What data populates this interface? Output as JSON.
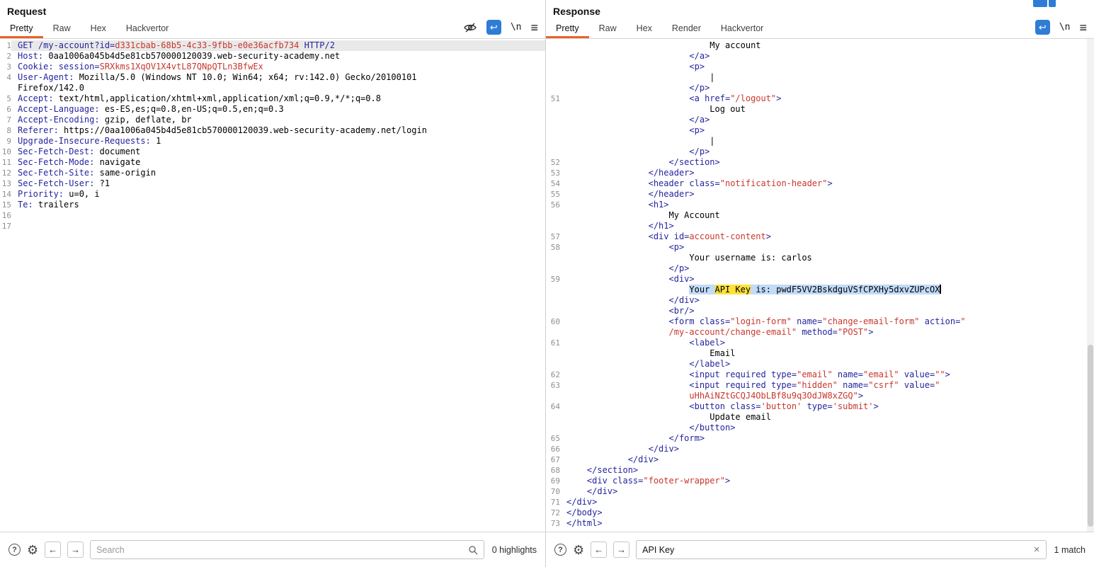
{
  "colors": {
    "syntax-blue": "#24249f",
    "syntax-red": "#c8372d",
    "selection": "#c2dbf7",
    "search-highlight": "#ffe13c",
    "accent-orange": "#e8632c",
    "wrap-blue": "#2e7cd6",
    "selected-line": "#e9e9e9"
  },
  "icons": {
    "wrap": "↩",
    "newline": "\\n",
    "menu": "≡",
    "help": "?",
    "gear": "⚙",
    "prev": "←",
    "next": "→",
    "clear": "×"
  },
  "request": {
    "title": "Request",
    "tabs": [
      "Pretty",
      "Raw",
      "Hex",
      "Hackvertor"
    ],
    "active_tab": "Pretty",
    "footer": {
      "search_placeholder": "Search",
      "count_label": "0 highlights"
    },
    "rows": [
      {
        "n": "1",
        "sel": true,
        "segs": [
          [
            "b",
            "GET /my-account?id="
          ],
          [
            "r",
            "d331cbab-68b5-4c33-9fbb-e0e36acfb734"
          ],
          [
            "b",
            " HTTP/2"
          ]
        ]
      },
      {
        "n": "2",
        "segs": [
          [
            "b",
            "Host:"
          ],
          [
            "k",
            " 0aa1006a045b4d5e81cb570000120039.web-security-academy.net"
          ]
        ]
      },
      {
        "n": "3",
        "segs": [
          [
            "b",
            "Cookie: session="
          ],
          [
            "r",
            "SRXkms1XqOV1X4vtL87QNpQTLn3BfwEx"
          ]
        ]
      },
      {
        "n": "4",
        "segs": [
          [
            "b",
            "User-Agent:"
          ],
          [
            "k",
            " Mozilla/5.0 (Windows NT 10.0; Win64; x64; rv:142.0) Gecko/20100101"
          ]
        ]
      },
      {
        "n": "",
        "segs": [
          [
            "k",
            "Firefox/142.0"
          ]
        ]
      },
      {
        "n": "5",
        "segs": [
          [
            "b",
            "Accept:"
          ],
          [
            "k",
            " text/html,application/xhtml+xml,application/xml;q=0.9,*/*;q=0.8"
          ]
        ]
      },
      {
        "n": "6",
        "segs": [
          [
            "b",
            "Accept-Language:"
          ],
          [
            "k",
            " es-ES,es;q=0.8,en-US;q=0.5,en;q=0.3"
          ]
        ]
      },
      {
        "n": "7",
        "segs": [
          [
            "b",
            "Accept-Encoding:"
          ],
          [
            "k",
            " gzip, deflate, br"
          ]
        ]
      },
      {
        "n": "8",
        "segs": [
          [
            "b",
            "Referer:"
          ],
          [
            "k",
            " https://0aa1006a045b4d5e81cb570000120039.web-security-academy.net/login"
          ]
        ]
      },
      {
        "n": "9",
        "segs": [
          [
            "b",
            "Upgrade-Insecure-Requests:"
          ],
          [
            "k",
            " 1"
          ]
        ]
      },
      {
        "n": "10",
        "segs": [
          [
            "b",
            "Sec-Fetch-Dest:"
          ],
          [
            "k",
            " document"
          ]
        ]
      },
      {
        "n": "11",
        "segs": [
          [
            "b",
            "Sec-Fetch-Mode:"
          ],
          [
            "k",
            " navigate"
          ]
        ]
      },
      {
        "n": "12",
        "segs": [
          [
            "b",
            "Sec-Fetch-Site:"
          ],
          [
            "k",
            " same-origin"
          ]
        ]
      },
      {
        "n": "13",
        "segs": [
          [
            "b",
            "Sec-Fetch-User:"
          ],
          [
            "k",
            " ?1"
          ]
        ]
      },
      {
        "n": "14",
        "segs": [
          [
            "b",
            "Priority:"
          ],
          [
            "k",
            " u=0, i"
          ]
        ]
      },
      {
        "n": "15",
        "segs": [
          [
            "b",
            "Te:"
          ],
          [
            "k",
            " trailers"
          ]
        ]
      },
      {
        "n": "16",
        "segs": []
      },
      {
        "n": "17",
        "segs": []
      }
    ]
  },
  "response": {
    "title": "Response",
    "tabs": [
      "Pretty",
      "Raw",
      "Hex",
      "Render",
      "Hackvertor"
    ],
    "active_tab": "Pretty",
    "footer": {
      "search_value": "API Key",
      "count_label": "1 match"
    },
    "rows": [
      {
        "n": "",
        "segs": [
          [
            "k",
            "                            My account"
          ]
        ]
      },
      {
        "n": "",
        "segs": [
          [
            "b",
            "                        </a>"
          ]
        ]
      },
      {
        "n": "",
        "segs": [
          [
            "b",
            "                        <p>"
          ]
        ]
      },
      {
        "n": "",
        "segs": [
          [
            "k",
            "                            |"
          ]
        ]
      },
      {
        "n": "",
        "segs": [
          [
            "b",
            "                        </p>"
          ]
        ]
      },
      {
        "n": "51",
        "segs": [
          [
            "b",
            "                        <a href="
          ],
          [
            "r",
            "\"/logout\""
          ],
          [
            "b",
            ">"
          ]
        ]
      },
      {
        "n": "",
        "segs": [
          [
            "k",
            "                            Log out"
          ]
        ]
      },
      {
        "n": "",
        "segs": [
          [
            "b",
            "                        </a>"
          ]
        ]
      },
      {
        "n": "",
        "segs": [
          [
            "b",
            "                        <p>"
          ]
        ]
      },
      {
        "n": "",
        "segs": [
          [
            "k",
            "                            |"
          ]
        ]
      },
      {
        "n": "",
        "segs": [
          [
            "b",
            "                        </p>"
          ]
        ]
      },
      {
        "n": "52",
        "segs": [
          [
            "b",
            "                    </section>"
          ]
        ]
      },
      {
        "n": "53",
        "segs": [
          [
            "b",
            "                </header>"
          ]
        ]
      },
      {
        "n": "54",
        "segs": [
          [
            "b",
            "                <header class="
          ],
          [
            "r",
            "\"notification-header\""
          ],
          [
            "b",
            ">"
          ]
        ]
      },
      {
        "n": "55",
        "segs": [
          [
            "b",
            "                </header>"
          ]
        ]
      },
      {
        "n": "56",
        "segs": [
          [
            "b",
            "                <h1>"
          ]
        ]
      },
      {
        "n": "",
        "segs": [
          [
            "k",
            "                    My Account"
          ]
        ]
      },
      {
        "n": "",
        "segs": [
          [
            "b",
            "                </h1>"
          ]
        ]
      },
      {
        "n": "57",
        "segs": [
          [
            "b",
            "                <div id="
          ],
          [
            "r",
            "account-content"
          ],
          [
            "b",
            ">"
          ]
        ]
      },
      {
        "n": "58",
        "segs": [
          [
            "b",
            "                    <p>"
          ]
        ]
      },
      {
        "n": "",
        "segs": [
          [
            "k",
            "                        Your username is: carlos"
          ]
        ]
      },
      {
        "n": "",
        "segs": [
          [
            "b",
            "                    </p>"
          ]
        ]
      },
      {
        "n": "59",
        "segs": [
          [
            "b",
            "                    <div>"
          ]
        ]
      },
      {
        "n": "",
        "cursor": true,
        "segs": [
          [
            "k",
            "                        "
          ],
          [
            "s",
            "Your "
          ],
          [
            "sy",
            "API Key"
          ],
          [
            "s",
            " is: pwdF5VV2BskdguVSfCPXHy5dxvZUPcOX"
          ]
        ]
      },
      {
        "n": "",
        "segs": [
          [
            "b",
            "                    </div>"
          ]
        ]
      },
      {
        "n": "",
        "segs": [
          [
            "b",
            "                    <br/>"
          ]
        ]
      },
      {
        "n": "60",
        "segs": [
          [
            "b",
            "                    <form class="
          ],
          [
            "r",
            "\"login-form\""
          ],
          [
            "b",
            " name="
          ],
          [
            "r",
            "\"change-email-form\""
          ],
          [
            "b",
            " action="
          ],
          [
            "r",
            "\""
          ]
        ]
      },
      {
        "n": "",
        "segs": [
          [
            "r",
            "                    /my-account/change-email\""
          ],
          [
            "b",
            " method="
          ],
          [
            "r",
            "\"POST\""
          ],
          [
            "b",
            ">"
          ]
        ]
      },
      {
        "n": "61",
        "segs": [
          [
            "b",
            "                        <label>"
          ]
        ]
      },
      {
        "n": "",
        "segs": [
          [
            "k",
            "                            Email"
          ]
        ]
      },
      {
        "n": "",
        "segs": [
          [
            "b",
            "                        </label>"
          ]
        ]
      },
      {
        "n": "62",
        "segs": [
          [
            "b",
            "                        <input required type="
          ],
          [
            "r",
            "\"email\""
          ],
          [
            "b",
            " name="
          ],
          [
            "r",
            "\"email\""
          ],
          [
            "b",
            " value="
          ],
          [
            "r",
            "\"\""
          ],
          [
            "b",
            ">"
          ]
        ]
      },
      {
        "n": "63",
        "segs": [
          [
            "b",
            "                        <input required type="
          ],
          [
            "r",
            "\"hidden\""
          ],
          [
            "b",
            " name="
          ],
          [
            "r",
            "\"csrf\""
          ],
          [
            "b",
            " value="
          ],
          [
            "r",
            "\""
          ]
        ]
      },
      {
        "n": "",
        "segs": [
          [
            "r",
            "                        uHhAiNZtGCQJ4ObLBf8u9q3OdJW8xZGQ\""
          ],
          [
            "b",
            ">"
          ]
        ]
      },
      {
        "n": "64",
        "segs": [
          [
            "b",
            "                        <button class="
          ],
          [
            "r",
            "'button'"
          ],
          [
            "b",
            " type="
          ],
          [
            "r",
            "'submit'"
          ],
          [
            "b",
            ">"
          ]
        ]
      },
      {
        "n": "",
        "segs": [
          [
            "k",
            "                            Update email"
          ]
        ]
      },
      {
        "n": "",
        "segs": [
          [
            "b",
            "                        </button>"
          ]
        ]
      },
      {
        "n": "65",
        "segs": [
          [
            "b",
            "                    </form>"
          ]
        ]
      },
      {
        "n": "66",
        "segs": [
          [
            "b",
            "                </div>"
          ]
        ]
      },
      {
        "n": "67",
        "segs": [
          [
            "b",
            "            </div>"
          ]
        ]
      },
      {
        "n": "68",
        "segs": [
          [
            "b",
            "    </section>"
          ]
        ]
      },
      {
        "n": "69",
        "segs": [
          [
            "b",
            "    <div class="
          ],
          [
            "r",
            "\"footer-wrapper\""
          ],
          [
            "b",
            ">"
          ]
        ]
      },
      {
        "n": "70",
        "segs": [
          [
            "b",
            "    </div>"
          ]
        ]
      },
      {
        "n": "71",
        "segs": [
          [
            "b",
            "</div>"
          ]
        ]
      },
      {
        "n": "72",
        "segs": [
          [
            "b",
            "</body>"
          ]
        ]
      },
      {
        "n": "73",
        "segs": [
          [
            "b",
            "</html>"
          ]
        ]
      }
    ]
  }
}
